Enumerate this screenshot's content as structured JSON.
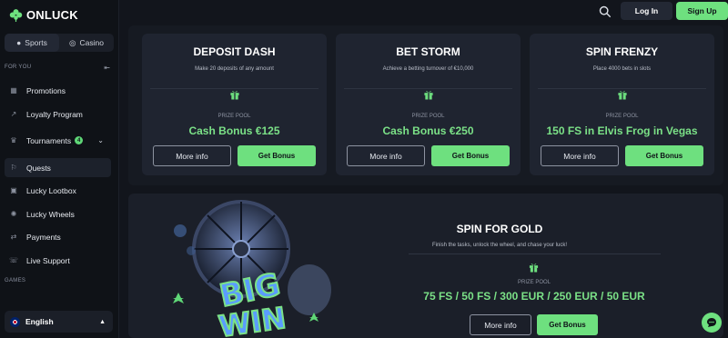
{
  "brand": {
    "name": "ONLUCK"
  },
  "mode_switch": {
    "sports": "Sports",
    "casino": "Casino",
    "active": "sports"
  },
  "sidebar": {
    "section_for_you": "FOR YOU",
    "items": [
      {
        "label": "Promotions",
        "icon": "promotions-icon"
      },
      {
        "label": "Loyalty Program",
        "icon": "loyalty-icon"
      },
      {
        "label": "Tournaments",
        "icon": "trophy-icon",
        "badge": "4"
      },
      {
        "label": "Quests",
        "icon": "quests-icon"
      },
      {
        "label": "Lucky Lootbox",
        "icon": "lootbox-icon"
      },
      {
        "label": "Lucky Wheels",
        "icon": "wheel-icon"
      },
      {
        "label": "Payments",
        "icon": "payments-icon"
      },
      {
        "label": "Live Support",
        "icon": "support-icon"
      }
    ],
    "section_games": "GAMES",
    "language": "English"
  },
  "topbar": {
    "login": "Log In",
    "signup": "Sign Up"
  },
  "cards": [
    {
      "title": "DEPOSIT DASH",
      "desc": "Make 20 deposits of any amount",
      "prize_label": "PRIZE POOL",
      "prize": "Cash Bonus €125",
      "more": "More info",
      "get": "Get Bonus"
    },
    {
      "title": "BET STORM",
      "desc": "Achieve a betting turnover of €10,000",
      "prize_label": "PRIZE POOL",
      "prize": "Cash Bonus €250",
      "more": "More info",
      "get": "Get Bonus"
    },
    {
      "title": "SPIN FRENZY",
      "desc": "Place 4000 bets in slots",
      "prize_label": "PRIZE POOL",
      "prize": "150 FS in Elvis Frog in Vegas",
      "more": "More info",
      "get": "Get Bonus"
    }
  ],
  "feature": {
    "title": "SPIN FOR GOLD",
    "desc": "Finish the tasks, unlock the wheel, and chase your luck!",
    "prize_label": "PRIZE POOL",
    "prize": "75 FS / 50 FS / 300 EUR / 250 EUR / 50 EUR",
    "more": "More info",
    "get": "Get Bonus"
  },
  "colors": {
    "accent": "#6ee07f",
    "bg": "#12151c",
    "card": "#1f2430"
  }
}
